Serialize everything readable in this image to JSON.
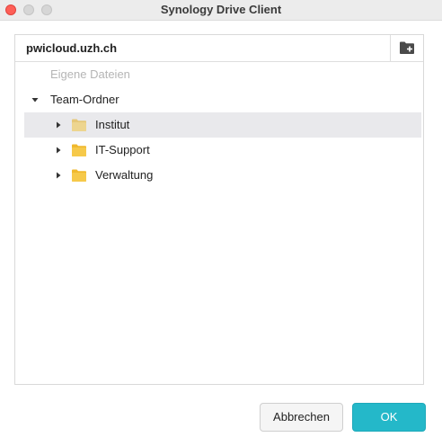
{
  "window": {
    "title": "Synology Drive Client"
  },
  "panel": {
    "server": "pwicloud.uzh.ch",
    "new_folder_icon": "new-folder-icon"
  },
  "tree": {
    "my_files": "Eigene Dateien",
    "team_folder": "Team-Ordner",
    "folders": [
      {
        "label": "Institut",
        "selected": true
      },
      {
        "label": "IT-Support",
        "selected": false
      },
      {
        "label": "Verwaltung",
        "selected": false
      }
    ]
  },
  "buttons": {
    "cancel": "Abbrechen",
    "ok": "OK"
  },
  "colors": {
    "accent": "#24b8c9",
    "selection": "#e9e9ec",
    "folder": "#f6c94a"
  }
}
